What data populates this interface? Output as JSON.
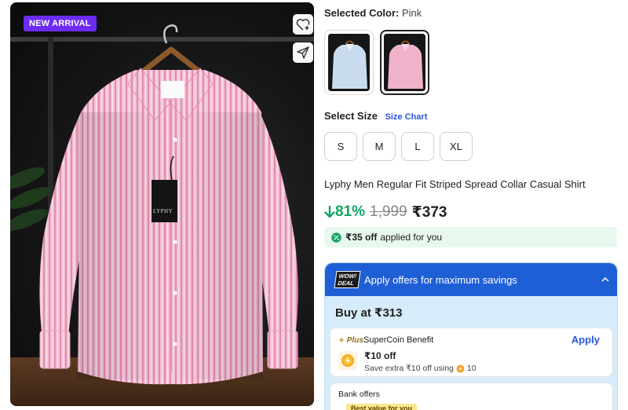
{
  "product": {
    "badge": "NEW ARRIVAL",
    "title": "Lyphy Men Regular Fit Striped Spread Collar Casual Shirt",
    "brand_tag": "LYPHY"
  },
  "color": {
    "label": "Selected Color:",
    "value": "Pink",
    "options": [
      "Light Blue",
      "Pink"
    ],
    "selected_index": 1
  },
  "size": {
    "label": "Select Size",
    "chart_link": "Size Chart",
    "options": [
      "S",
      "M",
      "L",
      "XL"
    ]
  },
  "price": {
    "discount": "81%",
    "mrp": "1,999",
    "selling": "₹373"
  },
  "applied": {
    "amount": "₹35 off",
    "text": "applied for you"
  },
  "offers": {
    "wow_line1": "WOW!",
    "wow_line2": "DEAL",
    "header": "Apply offers for maximum savings",
    "buy_at": "Buy at ₹313",
    "supercoin": {
      "plus": "Plus",
      "title": "SuperCoin Benefit",
      "apply": "Apply",
      "off": "₹10 off",
      "save_text": "Save extra ₹10 off using",
      "coins": "10"
    },
    "bank": {
      "title": "Bank offers",
      "best": "Best value for you"
    }
  },
  "colors": {
    "accent_blue": "#2a55e5",
    "discount_green": "#10a562",
    "badge_purple": "#6c2cf5",
    "offer_header": "#1f5fd6",
    "shirt_pink": "#f0b8cf"
  }
}
